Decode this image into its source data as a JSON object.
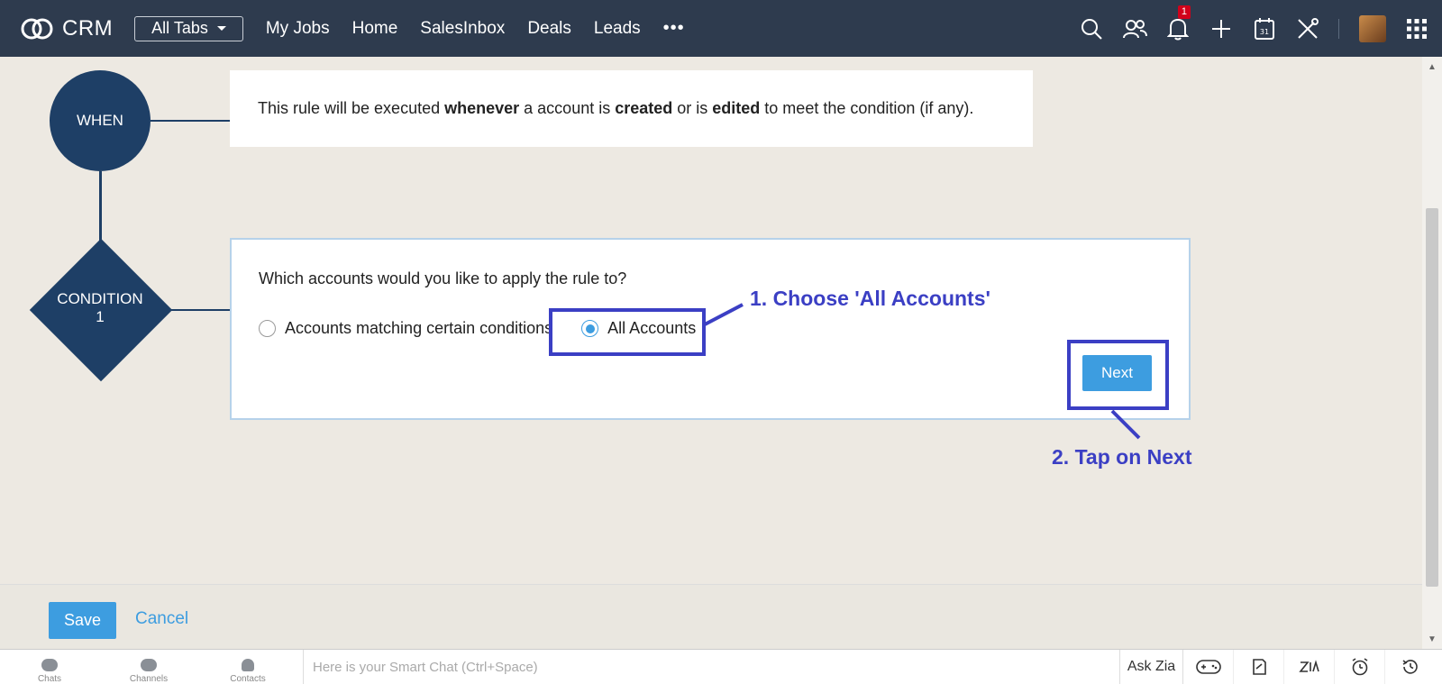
{
  "topbar": {
    "logo_text": "CRM",
    "all_tabs_label": "All Tabs",
    "nav": [
      "My Jobs",
      "Home",
      "SalesInbox",
      "Deals",
      "Leads"
    ],
    "more_label": "•••",
    "notification_count": "1",
    "icons": [
      "search-icon",
      "users-icon",
      "bell-icon",
      "plus-icon",
      "calendar-icon",
      "tools-icon",
      "avatar",
      "apps-grid-icon"
    ]
  },
  "flow": {
    "when_label": "WHEN",
    "condition_label_line1": "CONDITION",
    "condition_label_line2": "1",
    "when_text": {
      "p1": "This rule will be executed ",
      "b1": "whenever",
      "p2": " a account is ",
      "b2": "created",
      "p3": " or is ",
      "b3": "edited",
      "p4": " to meet the condition (if any)."
    },
    "question": "Which accounts would you like to apply the rule to?",
    "option_matching": "Accounts matching certain conditions",
    "option_all": "All Accounts",
    "selected": "All Accounts",
    "next_label": "Next"
  },
  "annotations": {
    "step1": "1. Choose 'All Accounts'",
    "step2": "2. Tap on Next",
    "color": "#3b3fc4"
  },
  "footer": {
    "save_label": "Save",
    "cancel_label": "Cancel"
  },
  "chatbar": {
    "tabs": [
      "Chats",
      "Channels",
      "Contacts"
    ],
    "placeholder": "Here is your Smart Chat (Ctrl+Space)",
    "ask_zia": "Ask Zia"
  },
  "colors": {
    "nav_bg": "#2e3b4e",
    "accent": "#3d9de0",
    "node": "#1e3f66"
  }
}
